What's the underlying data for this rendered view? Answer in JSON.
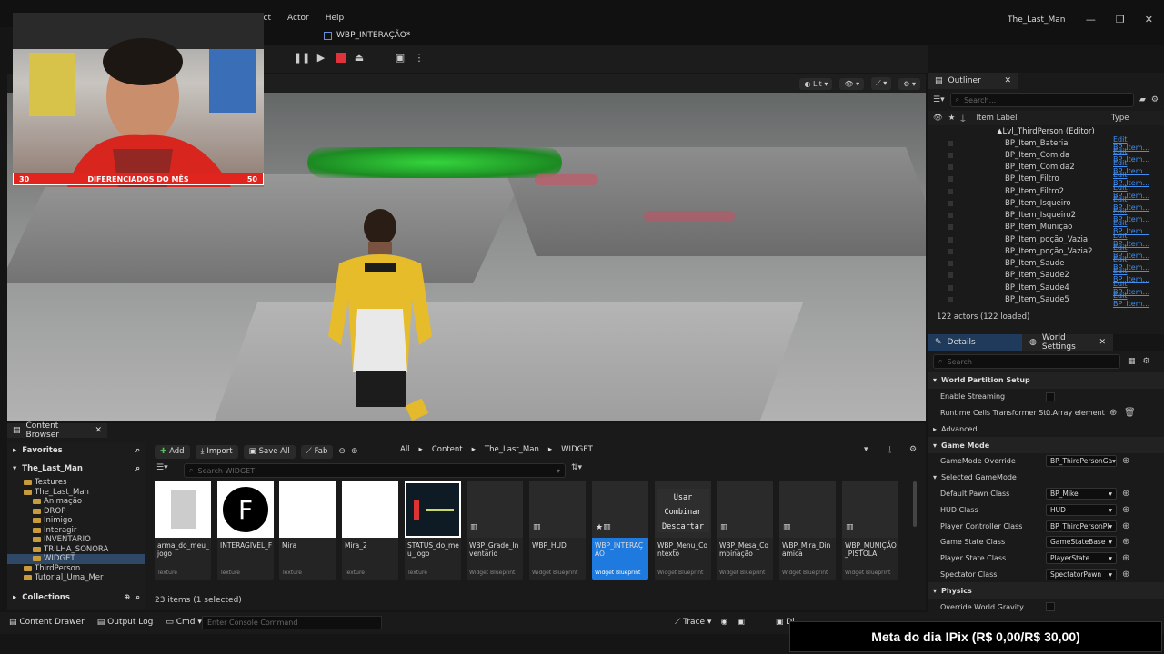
{
  "menu": [
    "ect",
    "Actor",
    "Help"
  ],
  "window_title": "The_Last_Man",
  "document_tab": "WBP_INTERAÇÃO*",
  "viewport": {
    "view_mode": "Lit"
  },
  "webcam": {
    "banner_left": "30",
    "banner_text": "DIFERENCIADOS DO MÊS",
    "banner_right": "50"
  },
  "outliner": {
    "tab": "Outliner",
    "search_placeholder": "Search...",
    "col_label": "Item Label",
    "col_type": "Type",
    "level": "Lvl_ThirdPerson (Editor)",
    "rows": [
      {
        "name": "BP_Item_Bateria",
        "type": "Edit BP_Item..."
      },
      {
        "name": "BP_Item_Comida",
        "type": "Edit BP_Item..."
      },
      {
        "name": "BP_Item_Comida2",
        "type": "Edit BP_Item..."
      },
      {
        "name": "BP_Item_Filtro",
        "type": "Edit BP_Item..."
      },
      {
        "name": "BP_Item_Filtro2",
        "type": "Edit BP_Item..."
      },
      {
        "name": "BP_Item_Isqueiro",
        "type": "Edit BP_Item..."
      },
      {
        "name": "BP_Item_Isqueiro2",
        "type": "Edit BP_Item..."
      },
      {
        "name": "BP_Item_Munição",
        "type": "Edit BP_Item..."
      },
      {
        "name": "BP_Item_poção_Vazia",
        "type": "Edit BP_Item..."
      },
      {
        "name": "BP_Item_poção_Vazia2",
        "type": "Edit BP_Item..."
      },
      {
        "name": "BP_Item_Saude",
        "type": "Edit BP_Item..."
      },
      {
        "name": "BP_Item_Saude2",
        "type": "Edit BP_Item..."
      },
      {
        "name": "BP_Item_Saude4",
        "type": "Edit BP_Item..."
      },
      {
        "name": "BP_Item_Saude5",
        "type": "Edit BP_Item..."
      }
    ],
    "actors": "122 actors (122 loaded)"
  },
  "details": {
    "tab_details": "Details",
    "tab_world": "World Settings",
    "search_placeholder": "Search",
    "rows": [
      {
        "label": "World Partition Setup",
        "kind": "section"
      },
      {
        "label": "Enable Streaming",
        "kind": "check"
      },
      {
        "label": "Runtime Cells Transformer St...",
        "kind": "text",
        "value": "0 Array element"
      },
      {
        "label": "Advanced",
        "kind": "sub"
      },
      {
        "label": "Game Mode",
        "kind": "section"
      },
      {
        "label": "GameMode Override",
        "kind": "combo",
        "value": "BP_ThirdPersonGa"
      },
      {
        "label": "Selected GameMode",
        "kind": "sub"
      },
      {
        "label": "Default Pawn Class",
        "kind": "combo",
        "value": "BP_Mike"
      },
      {
        "label": "HUD Class",
        "kind": "combo",
        "value": "HUD"
      },
      {
        "label": "Player Controller Class",
        "kind": "combo",
        "value": "BP_ThirdPersonPl"
      },
      {
        "label": "Game State Class",
        "kind": "combo",
        "value": "GameStateBase"
      },
      {
        "label": "Player State Class",
        "kind": "combo",
        "value": "PlayerState"
      },
      {
        "label": "Spectator Class",
        "kind": "combo",
        "value": "SpectatorPawn"
      },
      {
        "label": "Physics",
        "kind": "section"
      },
      {
        "label": "Override World Gravity",
        "kind": "check"
      }
    ]
  },
  "content_browser": {
    "tab": "Content Browser",
    "favorites": "Favorites",
    "project": "The_Last_Man",
    "tree": [
      {
        "label": "Textures",
        "indent": 1
      },
      {
        "label": "The_Last_Man",
        "indent": 1
      },
      {
        "label": "Animação",
        "indent": 2
      },
      {
        "label": "DROP",
        "indent": 2
      },
      {
        "label": "Inimigo",
        "indent": 2
      },
      {
        "label": "Interagir",
        "indent": 2
      },
      {
        "label": "INVENTARIO",
        "indent": 2
      },
      {
        "label": "TRILHA_SONORA",
        "indent": 2
      },
      {
        "label": "WIDGET",
        "indent": 2
      },
      {
        "label": "ThirdPerson",
        "indent": 1
      },
      {
        "label": "Tutorial_Uma_Mer",
        "indent": 1
      }
    ],
    "collections": "Collections",
    "add": "Add",
    "import": "Import",
    "save_all": "Save All",
    "fab": "Fab",
    "breadcrumb": [
      "All",
      "Content",
      "The_Last_Man",
      "WIDGET"
    ],
    "search_placeholder": "Search WIDGET",
    "assets": [
      {
        "name": "arma_do_meu_jogo",
        "type": "Texture"
      },
      {
        "name": "INTERAGIVEL_F",
        "type": "Texture"
      },
      {
        "name": "Mira",
        "type": "Texture"
      },
      {
        "name": "Mira_2",
        "type": "Texture"
      },
      {
        "name": "STATUS_do_meu_jogo",
        "type": "Texture"
      },
      {
        "name": "WBP_Grade_Inventario",
        "type": "Widget Blueprint"
      },
      {
        "name": "WBP_HUD",
        "type": "Widget Blueprint"
      },
      {
        "name": "WBP_INTERAÇÃO",
        "type": "Widget Blueprint"
      },
      {
        "name": "WBP_Menu_Contexto",
        "type": "Widget Blueprint"
      },
      {
        "name": "WBP_Mesa_Combinação",
        "type": "Widget Blueprint"
      },
      {
        "name": "WBP_Mira_Dinamica",
        "type": "Widget Blueprint"
      },
      {
        "name": "WBP_MUNIÇÃO_PISTOLA",
        "type": "Widget Blueprint"
      }
    ],
    "context_menu": [
      "Usar",
      "Combinar",
      "Descartar"
    ],
    "thumb_letter": "F",
    "count": "23 items (1 selected)"
  },
  "statusbar": {
    "content_drawer": "Content Drawer",
    "output_log": "Output Log",
    "cmd": "Cmd",
    "console_placeholder": "Enter Console Command",
    "trace": "Trace",
    "di": "Di"
  },
  "stream_meta": "Meta do dia !Pix (R$ 0,00/R$ 30,00)"
}
